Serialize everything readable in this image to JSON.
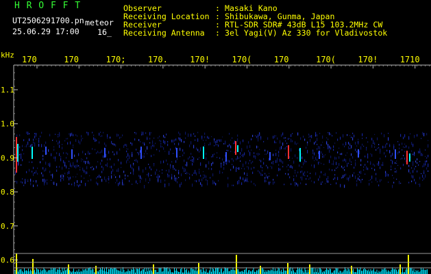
{
  "header": {
    "station_name": "H R O F F T",
    "file_name": "UT2506291700.pn",
    "date_time": "25.06.29 17:00",
    "meteor_label": "meteor",
    "meteor_count": "16_",
    "info_labels": [
      "Observer",
      "Receiving Location",
      "Receiver",
      "Receiving Antenna"
    ],
    "info_values": [
      ": Masaki Kano",
      ": Shibukawa, Gunma, Japan",
      ": RTL-SDR SDR# 43dB L15 103.2MHz CW",
      ": 3el Yagi(V) Az 330 for Vladivostok"
    ]
  },
  "axes": {
    "y_unit": "kHz",
    "y_ticks": [
      "1.1",
      "1.0",
      "0.9",
      "0.8",
      "0.7",
      "0.6"
    ],
    "y_values": [
      1.1,
      1.0,
      0.9,
      0.8,
      0.7,
      0.6
    ],
    "x_ticks": [
      "170",
      "170",
      "170;",
      "170.",
      "170!",
      "170(",
      "170",
      "170(",
      "170!",
      "1710"
    ]
  },
  "colors": {
    "background": "#000000",
    "text_yellow": "#ffff00",
    "station_green": "#35ff35",
    "signal_band": "#0f1f88",
    "meteor_red": "#ff3030",
    "meteor_cyan": "#00ffff",
    "strength_cyan": "#00e5ff",
    "strength_yellow": "#ffff00"
  }
}
